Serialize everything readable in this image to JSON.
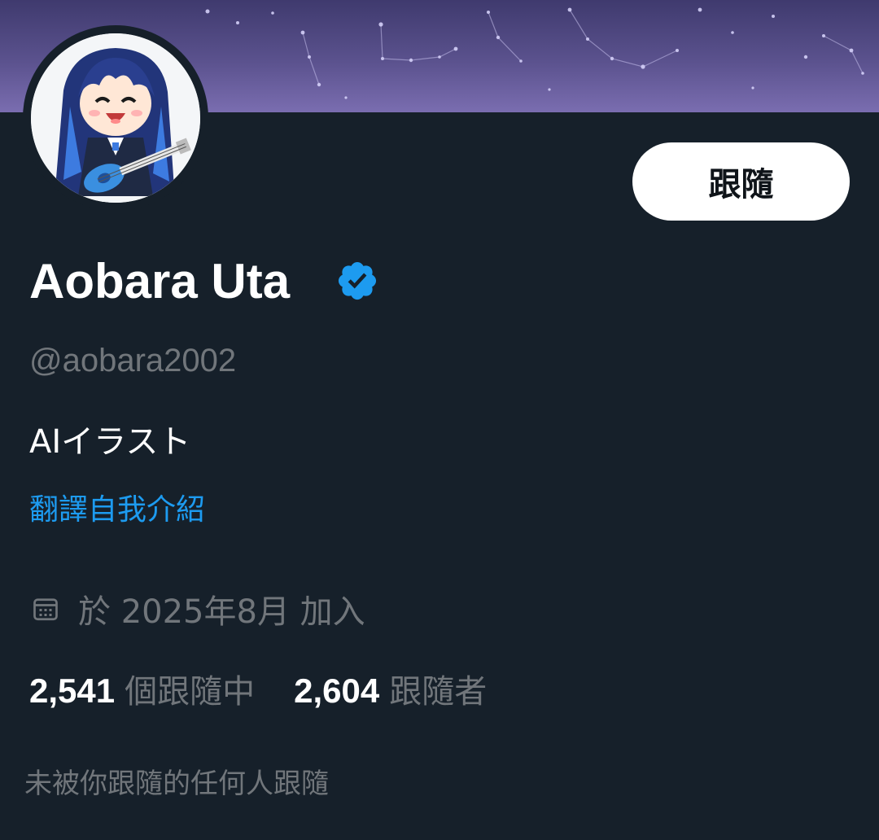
{
  "profile": {
    "display_name": "Aobara Uta",
    "handle": "@aobara2002",
    "bio": "AIイラスト",
    "translate_bio_label": "翻譯自我介紹",
    "joined_text": "於 2025年8月 加入",
    "verified_icon": "verified-badge-icon",
    "verified_color": "#1d9bf0"
  },
  "actions": {
    "follow_label": "跟隨"
  },
  "stats": {
    "following_count": "2,541",
    "following_label": "個跟隨中",
    "followers_count": "2,604",
    "followers_label": "跟隨者"
  },
  "footer": {
    "not_followed_text": "未被你跟隨的任何人跟隨"
  },
  "colors": {
    "background": "#16202a",
    "accent": "#1d9bf0",
    "muted_text": "#71767b",
    "banner": "#5b528e"
  }
}
